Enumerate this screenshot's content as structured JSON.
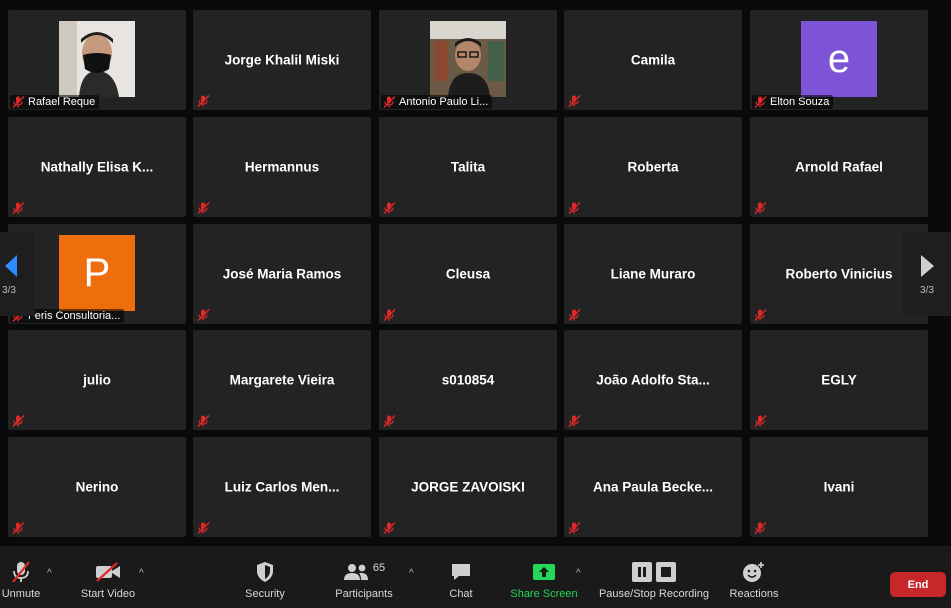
{
  "participants": [
    {
      "name": "Rafael Reque",
      "type": "photo",
      "photo": "masked-person"
    },
    {
      "name": "Jorge Khalil Miski",
      "type": "name"
    },
    {
      "name": "Antonio Paulo Li...",
      "type": "photo",
      "photo": "glasses-person"
    },
    {
      "name": "Camila",
      "type": "name"
    },
    {
      "name": "Elton Souza",
      "type": "letter",
      "letter": "e",
      "color": "#7e54d6"
    },
    {
      "name": "Nathally Elisa K...",
      "type": "name"
    },
    {
      "name": "Hermannus",
      "type": "name"
    },
    {
      "name": "Talita",
      "type": "name"
    },
    {
      "name": "Roberta",
      "type": "name"
    },
    {
      "name": "Arnold Rafael",
      "type": "name"
    },
    {
      "name": "Feris Consultoria...",
      "type": "letter",
      "letter": "P",
      "color": "#ee6e0e"
    },
    {
      "name": "José Maria Ramos",
      "type": "name"
    },
    {
      "name": "Cleusa",
      "type": "name"
    },
    {
      "name": "Liane Muraro",
      "type": "name"
    },
    {
      "name": "Roberto Vinicius",
      "type": "name"
    },
    {
      "name": "julio",
      "type": "name"
    },
    {
      "name": "Margarete Vieira",
      "type": "name"
    },
    {
      "name": "s010854",
      "type": "name"
    },
    {
      "name": "João Adolfo Sta...",
      "type": "name"
    },
    {
      "name": "EGLY",
      "type": "name"
    },
    {
      "name": "Nerino",
      "type": "name"
    },
    {
      "name": "Luiz Carlos Men...",
      "type": "name"
    },
    {
      "name": "JORGE ZAVOISKI",
      "type": "name"
    },
    {
      "name": "Ana Paula Becke...",
      "type": "name"
    },
    {
      "name": "Ivani",
      "type": "name"
    }
  ],
  "pager": {
    "left_label": "3/3",
    "right_label": "3/3",
    "left_arrow_color": "#2d8cff"
  },
  "toolbar": {
    "unmute": "Unmute",
    "start_video": "Start Video",
    "security": "Security",
    "participants": "Participants",
    "participants_count": "65",
    "chat": "Chat",
    "share_screen": "Share Screen",
    "recording": "Pause/Stop Recording",
    "reactions": "Reactions",
    "end": "End"
  },
  "colors": {
    "tile": "#232323",
    "muted_icon": "#e02828",
    "share_green": "#23d959",
    "end_red": "#c7262a"
  }
}
